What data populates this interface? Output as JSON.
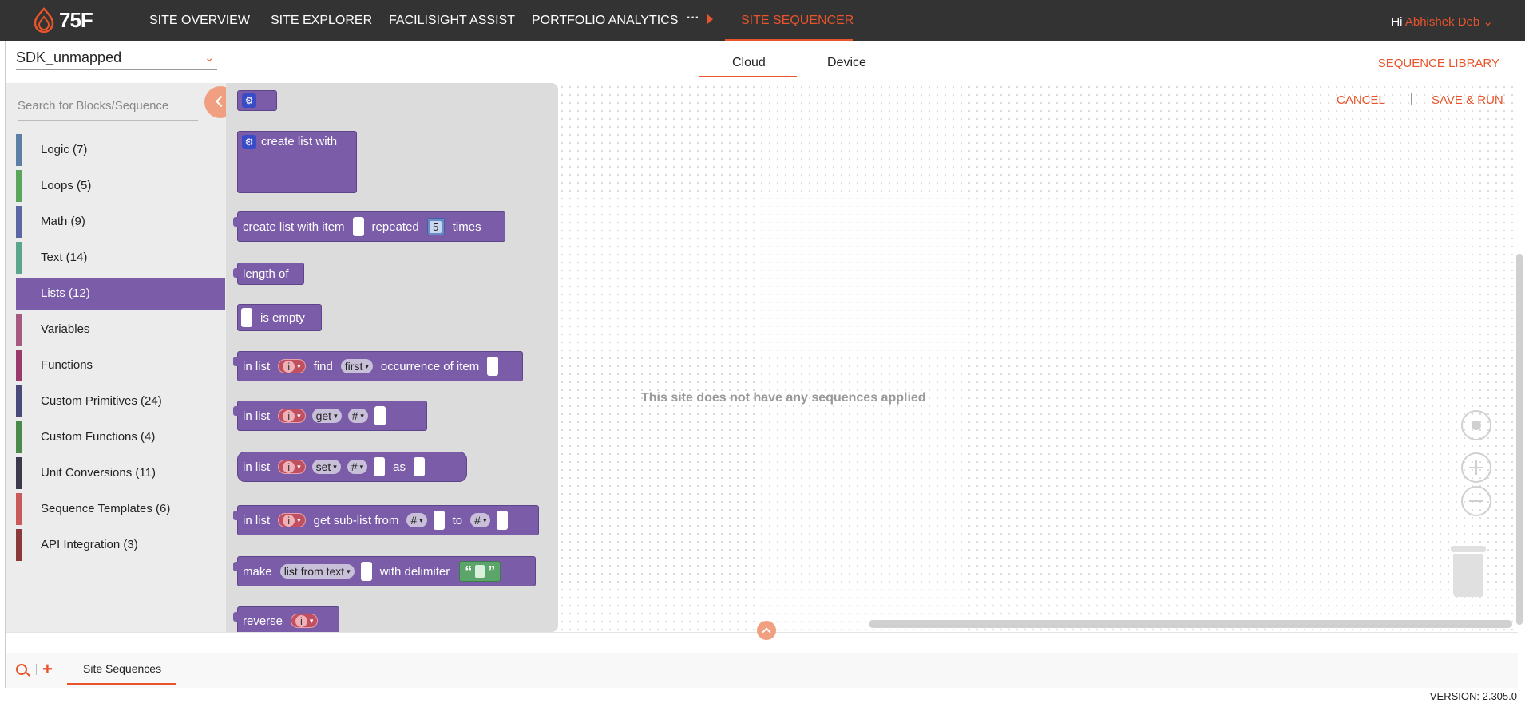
{
  "nav": {
    "logo": "75F",
    "items": [
      "SITE OVERVIEW",
      "SITE EXPLORER",
      "FACILISIGHT ASSIST",
      "PORTFOLIO ANALYTICS"
    ],
    "more": "···",
    "active": "SITE SEQUENCER",
    "greeting": "Hi",
    "user": "Abhishek Deb"
  },
  "site_select": {
    "value": "SDK_unmapped"
  },
  "tabs": [
    "Cloud",
    "Device"
  ],
  "actions": {
    "library": "SEQUENCE LIBRARY",
    "cancel": "CANCEL",
    "save_run": "SAVE & RUN"
  },
  "search": {
    "placeholder": "Search for Blocks/Sequence"
  },
  "categories": [
    {
      "label": "Logic (7)",
      "color": "#5b80a5"
    },
    {
      "label": "Loops (5)",
      "color": "#5ba55b"
    },
    {
      "label": "Math (9)",
      "color": "#5b67a5"
    },
    {
      "label": "Text (14)",
      "color": "#5ba58c"
    },
    {
      "label": "Lists (12)",
      "color": "#7b5ca8"
    },
    {
      "label": "Variables",
      "color": "#a55b80"
    },
    {
      "label": "Functions",
      "color": "#9a3a6a"
    },
    {
      "label": "Custom Primitives (24)",
      "color": "#4a4a7a"
    },
    {
      "label": "Custom Functions (4)",
      "color": "#4a8a4a"
    },
    {
      "label": "Unit Conversions (11)",
      "color": "#3a3a4a"
    },
    {
      "label": "Sequence Templates (6)",
      "color": "#c85a5a"
    },
    {
      "label": "API Integration (3)",
      "color": "#8a3a3a"
    }
  ],
  "blocks": {
    "create_list": "create list with",
    "repeat": {
      "a": "create list with item",
      "b": "repeated",
      "n": "5",
      "c": "times"
    },
    "length": "length of",
    "is_empty": "is empty",
    "find": {
      "a": "in list",
      "var": "i",
      "b": "find",
      "dd": "first",
      "c": "occurrence of item"
    },
    "get": {
      "a": "in list",
      "var": "i",
      "dd": "get",
      "dd2": "#"
    },
    "set": {
      "a": "in list",
      "var": "i",
      "dd": "set",
      "dd2": "#",
      "b": "as"
    },
    "sublist": {
      "a": "in list",
      "var": "i",
      "b": "get sub-list from",
      "dd": "#",
      "c": "to",
      "dd2": "#"
    },
    "make": {
      "a": "make",
      "dd": "list from text",
      "b": "with delimiter",
      "q1": "“",
      "q2": "”"
    },
    "reverse": {
      "a": "reverse",
      "var": "i"
    }
  },
  "workspace": {
    "empty_message": "This site does not have any sequences applied"
  },
  "bottom": {
    "tab": "Site Sequences",
    "plus": "+",
    "version": "VERSION: 2.305.0"
  }
}
